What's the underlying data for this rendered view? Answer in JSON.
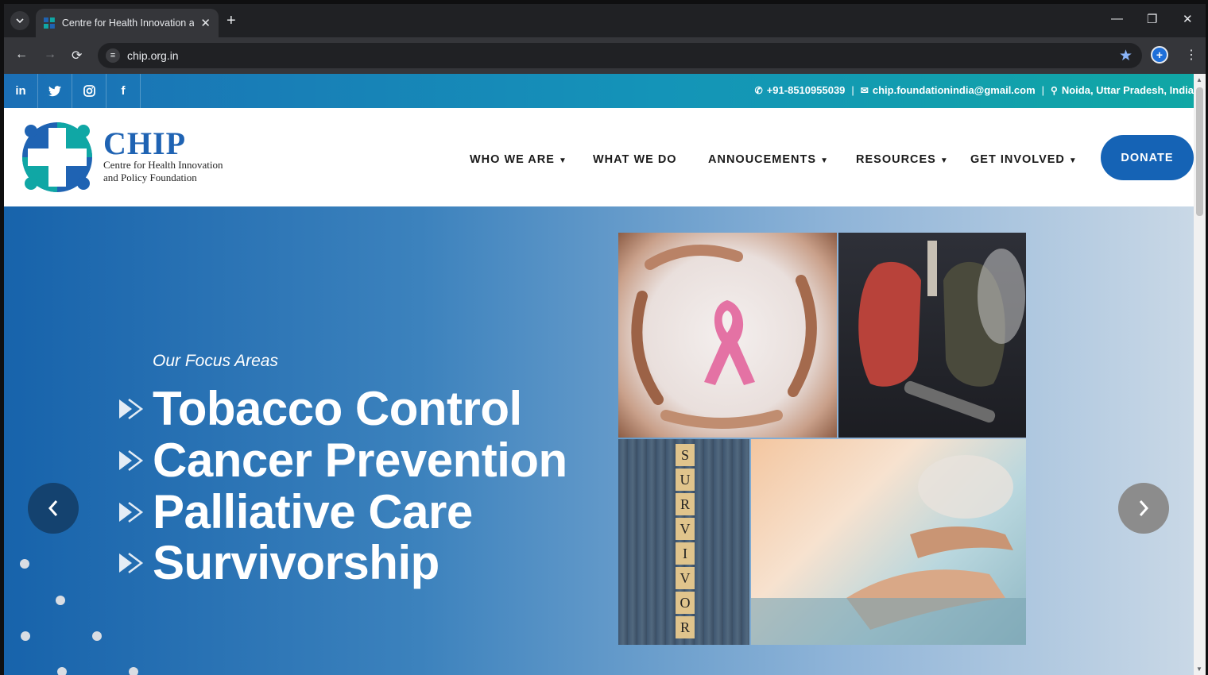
{
  "browser": {
    "tab_title": "Centre for Health Innovation and Policy Foundation",
    "new_tab": "+",
    "tab_close": "✕",
    "url": "chip.org.in"
  },
  "topbar": {
    "social": [
      "in",
      "",
      "",
      "f"
    ],
    "phone": "+91-8510955039",
    "email": "chip.foundationindia@gmail.com",
    "location": "Noida, Uttar Pradesh, India",
    "separator": "|"
  },
  "header": {
    "logo_big": "CHIP",
    "logo_sub_1": "Centre for Health Innovation",
    "logo_sub_2": "and Policy Foundation",
    "nav": [
      {
        "label": "WHO WE ARE",
        "dropdown": true
      },
      {
        "label": "WHAT WE DO",
        "dropdown": false
      },
      {
        "label": "ANNOUCEMENTS",
        "dropdown": true
      },
      {
        "label": "RESOURCES",
        "dropdown": true
      },
      {
        "label": "GET INVOLVED",
        "dropdown": true
      }
    ],
    "donate": "DONATE"
  },
  "hero": {
    "eyebrow": "Our Focus Areas",
    "focus_areas": [
      "Tobacco Control",
      "Cancer Prevention",
      "Palliative Care",
      "Survivorship"
    ],
    "tiles": [
      "S",
      "U",
      "R",
      "V",
      "I",
      "V",
      "O",
      "R"
    ]
  },
  "colors": {
    "brand_blue": "#1563b5",
    "teal": "#10a7a5",
    "logo_blue": "#1f63b3"
  }
}
